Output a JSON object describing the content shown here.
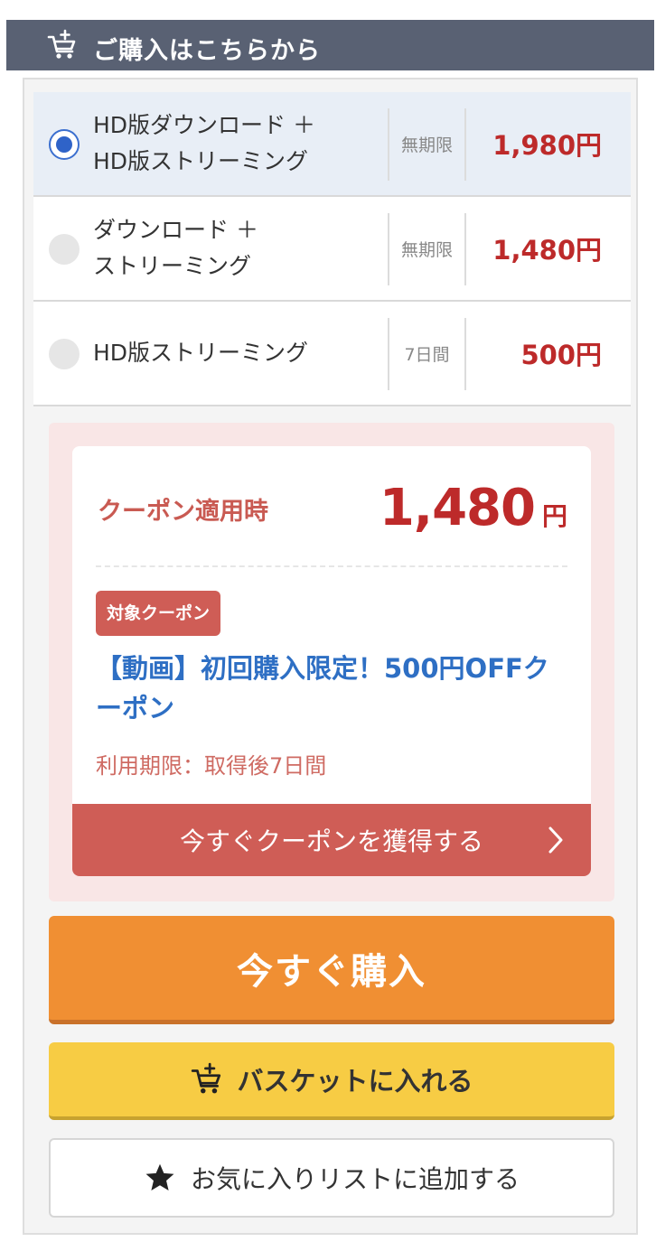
{
  "header": {
    "title": "ご購入はこちらから",
    "icon": "cart-add-icon"
  },
  "options": [
    {
      "line1": "HD版ダウンロード ＋",
      "line2": "HD版ストリーミング",
      "period": "無期限",
      "price": "1,980円",
      "selected": true
    },
    {
      "line1": "ダウンロード ＋",
      "line2": "ストリーミング",
      "period": "無期限",
      "price": "1,480円",
      "selected": false
    },
    {
      "line1": "HD版ストリーミング",
      "line2": "",
      "period": "7日間",
      "price": "500円",
      "selected": false
    }
  ],
  "coupon": {
    "label": "クーポン適用時",
    "price": "1,480",
    "currency": "円",
    "tag": "対象クーポン",
    "name": "【動画】初回購入限定！500円OFFクーポン",
    "expiry": "利用期限：取得後7日間",
    "button": "今すぐクーポンを獲得する"
  },
  "buttons": {
    "buy": "今すぐ購入",
    "basket": "バスケットに入れる",
    "favorite": "お気に入りリストに追加する"
  },
  "colors": {
    "header_bg": "#596173",
    "price_red": "#bd2a2a",
    "selected_bg": "#e8eef6",
    "radio_blue": "#2f63c8",
    "coupon_bg": "#f9e6e6",
    "coupon_red": "#cf5d56",
    "coupon_link": "#2e6fc4",
    "buy_orange": "#f08f33",
    "basket_yellow": "#f7cc44"
  }
}
